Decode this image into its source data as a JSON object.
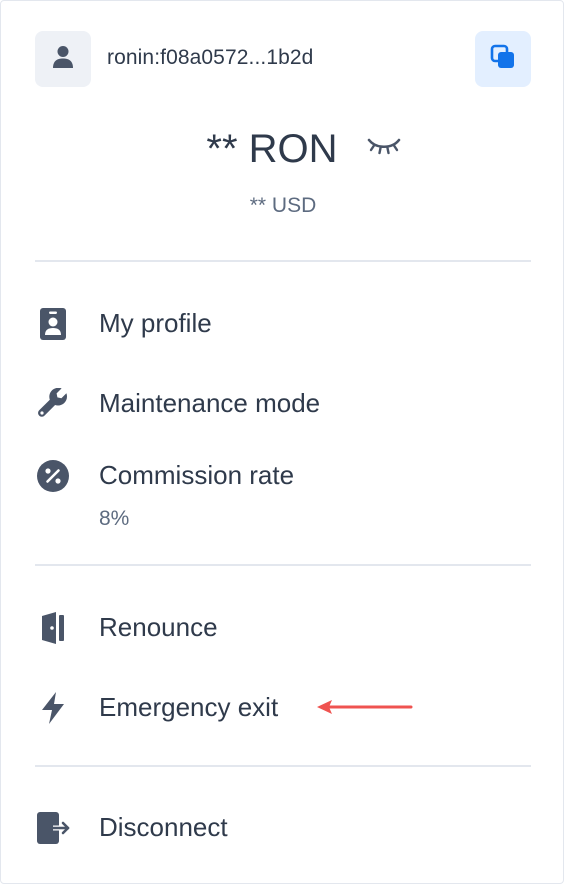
{
  "account": {
    "address": "ronin:f08a0572...1b2d",
    "avatar_icon": "user-icon",
    "copy_icon": "copy-icon"
  },
  "balance": {
    "amount": "** RON",
    "usd": "** USD",
    "visibility_icon": "eye-closed-icon"
  },
  "menu": {
    "profile": {
      "label": "My profile",
      "icon": "profile-badge-icon"
    },
    "maintenance": {
      "label": "Maintenance mode",
      "icon": "wrench-icon"
    },
    "commission": {
      "label": "Commission rate",
      "value": "8%",
      "icon": "percent-icon"
    },
    "renounce": {
      "label": "Renounce",
      "icon": "door-icon"
    },
    "emergency": {
      "label": "Emergency exit",
      "icon": "bolt-icon"
    },
    "disconnect": {
      "label": "Disconnect",
      "icon": "logout-icon"
    }
  },
  "colors": {
    "text": "#2f3a4b",
    "muted": "#5d6b80",
    "accent": "#1273ea",
    "accent_bg": "#e3efff",
    "annotation_arrow": "#ef5350"
  }
}
